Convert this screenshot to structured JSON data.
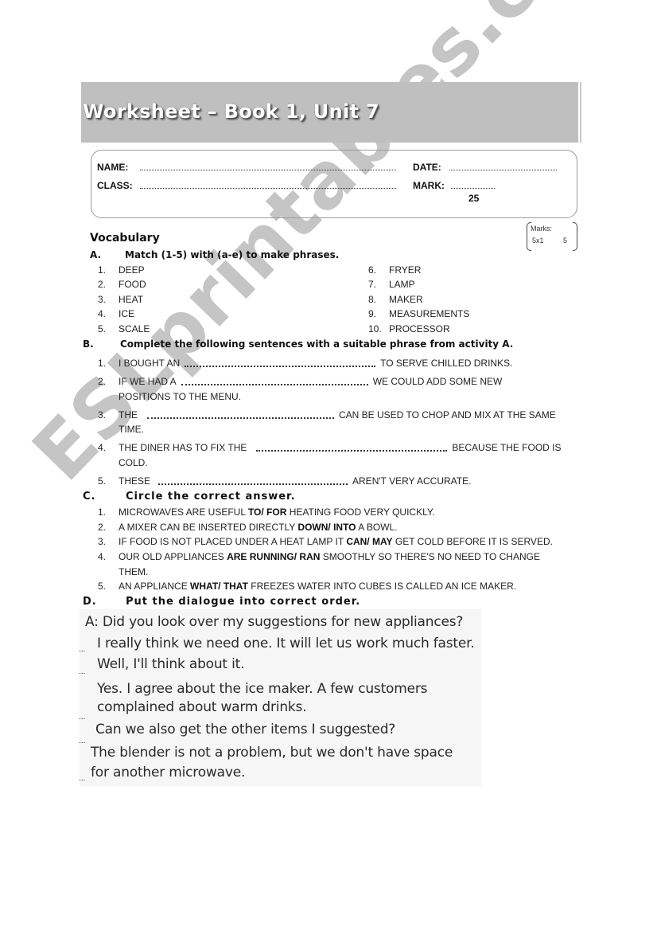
{
  "header": {
    "title": "Worksheet – Book 1, Unit 7"
  },
  "info": {
    "name_label": "NAME:",
    "date_label": "DATE:",
    "class_label": "CLASS:",
    "mark_label": "MARK:",
    "mark_total": "25"
  },
  "vocabulary": {
    "heading": "Vocabulary",
    "marks_box": {
      "label": "Marks:",
      "formula": "5x1",
      "value": "5"
    }
  },
  "section_a": {
    "letter": "A.",
    "instruction": "Match (1-5) with (a-e) to make phrases.",
    "left_items": [
      {
        "num": "1.",
        "word": "DEEP"
      },
      {
        "num": "2.",
        "word": "FOOD"
      },
      {
        "num": "3.",
        "word": "HEAT"
      },
      {
        "num": "4.",
        "word": "ICE"
      },
      {
        "num": "5.",
        "word": "SCALE"
      }
    ],
    "right_items": [
      {
        "num": "6.",
        "word": "FRYER"
      },
      {
        "num": "7.",
        "word": "LAMP"
      },
      {
        "num": "8.",
        "word": "MAKER"
      },
      {
        "num": "9.",
        "word": "MEASUREMENTS"
      },
      {
        "num": "10.",
        "word": "PROCESSOR"
      }
    ]
  },
  "section_b": {
    "letter": "B.",
    "instruction": "Complete the following sentences with a suitable phrase from activity A.",
    "items": [
      {
        "num": "1.",
        "before": "I BOUGHT AN",
        "after": "TO SERVE CHILLED DRINKS.",
        "continuation": ""
      },
      {
        "num": "2.",
        "before": "IF WE HAD A",
        "after": "WE COULD ADD SOME NEW",
        "continuation": "POSITIONS TO THE MENU."
      },
      {
        "num": "3.",
        "before": "THE",
        "after": "CAN BE USED TO CHOP AND MIX AT THE SAME",
        "continuation": "TIME."
      },
      {
        "num": "4.",
        "before": "THE DINER HAS TO FIX THE",
        "after": "BECAUSE THE FOOD IS",
        "continuation": "COLD."
      },
      {
        "num": "5.",
        "before": "THESE",
        "after": "AREN'T VERY ACCURATE.",
        "continuation": ""
      }
    ]
  },
  "section_c": {
    "letter": "C.",
    "instruction": "Circle the correct answer.",
    "items": [
      {
        "num": "1.",
        "before": "MICROWAVES ARE USEFUL",
        "options": "TO/ FOR",
        "after": "HEATING FOOD VERY QUICKLY.",
        "continuation": ""
      },
      {
        "num": "2.",
        "before": "A MIXER CAN BE INSERTED DIRECTLY",
        "options": "DOWN/ INTO",
        "after": "A BOWL.",
        "continuation": ""
      },
      {
        "num": "3.",
        "before": "IF FOOD IS NOT PLACED UNDER A HEAT LAMP IT",
        "options": "CAN/ MAY",
        "after": "GET COLD BEFORE IT IS SERVED.",
        "continuation": ""
      },
      {
        "num": "4.",
        "before": "OUR OLD APPLIANCES",
        "options": "ARE RUNNING/ RAN",
        "after": "SMOOTHLY SO THERE'S NO NEED TO CHANGE",
        "continuation": "THEM."
      },
      {
        "num": "5.",
        "before": "AN APPLIANCE",
        "options": "WHAT/ THAT",
        "after": "FREEZES WATER INTO CUBES IS CALLED AN ICE MAKER.",
        "continuation": ""
      }
    ]
  },
  "section_d": {
    "letter": "D.",
    "instruction": "Put the dialogue into correct order.",
    "lines": [
      "A:  Did you look over my suggestions for new appliances?",
      "I really think we need one. It will let us work much faster.",
      "Well, I'll think about it.",
      "Yes. I agree about the ice maker. A few customers",
      "complained about warm drinks.",
      "Can we also get the other items I suggested?",
      "The blender is not a problem, but we don't have space",
      "for another microwave."
    ],
    "order_marker": "..."
  },
  "watermark": "ESLprintables.com"
}
